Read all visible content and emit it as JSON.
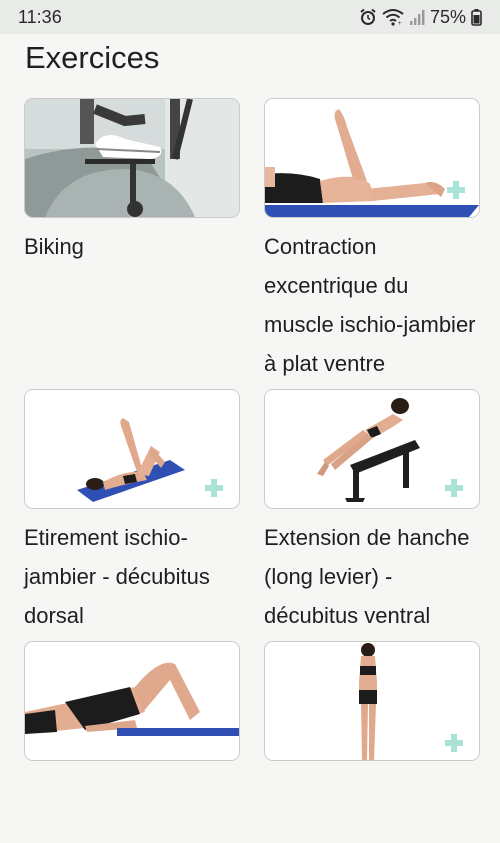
{
  "status_bar": {
    "time": "11:36",
    "battery": "75%",
    "icons": [
      "alarm-icon",
      "wifi-icon",
      "signal-icon",
      "battery-icon"
    ]
  },
  "page": {
    "title": "Exercices"
  },
  "exercises": [
    {
      "label": "Biking",
      "image": "biking-image"
    },
    {
      "label": "Contraction excentrique du muscle ischio-jambier à plat ventre",
      "image": "prone-leg-curl-image"
    },
    {
      "label": "Etirement ischio-jambier - décubitus dorsal",
      "image": "supine-hamstring-stretch-image"
    },
    {
      "label": "Extension de hanche (long levier) - décubitus ventral",
      "image": "prone-hip-extension-image"
    },
    {
      "label": "",
      "image": "bridge-image"
    },
    {
      "label": "",
      "image": "standing-image"
    }
  ],
  "colors": {
    "accent_plus": "#a9e3d7",
    "mat_blue": "#2d4fb8",
    "background": "#f6f7f5"
  }
}
